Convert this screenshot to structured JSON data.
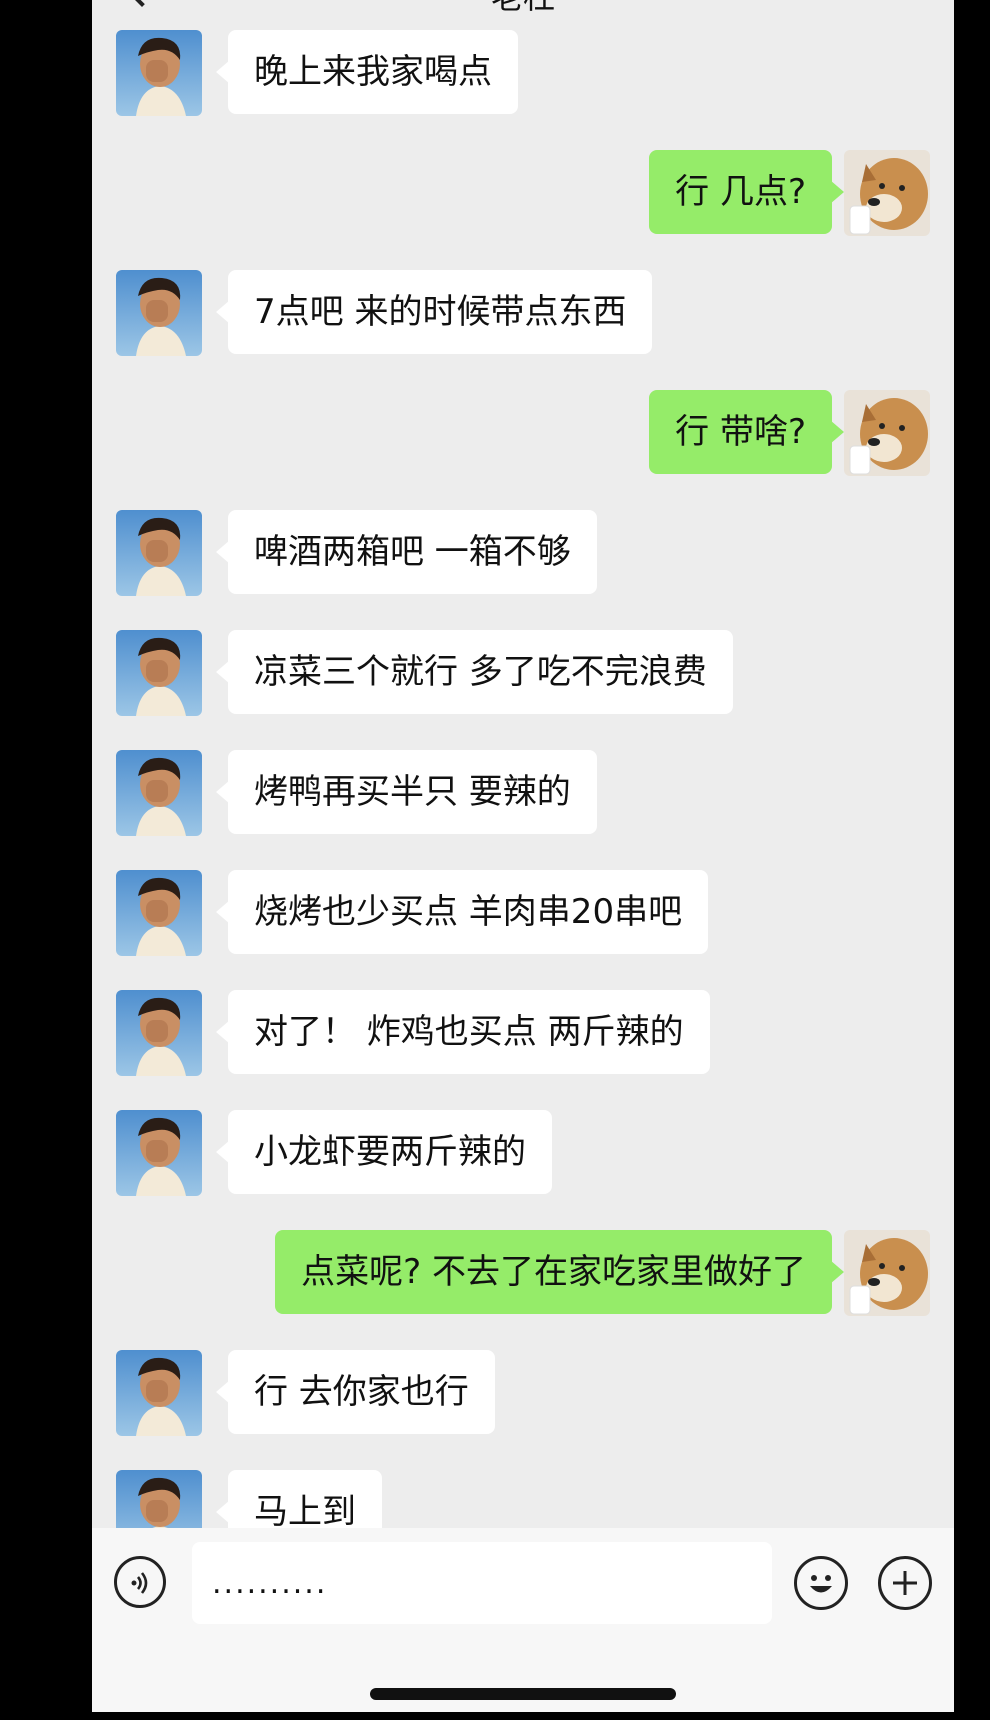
{
  "header": {
    "title": "老杜"
  },
  "messages": [
    {
      "side": "left",
      "text": "晚上来我家喝点"
    },
    {
      "side": "right",
      "text": "行 几点?"
    },
    {
      "side": "left",
      "text": "7点吧 来的时候带点东西"
    },
    {
      "side": "right",
      "text": "行 带啥?"
    },
    {
      "side": "left",
      "text": "啤酒两箱吧 一箱不够"
    },
    {
      "side": "left",
      "text": "凉菜三个就行 多了吃不完浪费"
    },
    {
      "side": "left",
      "text": "烤鸭再买半只 要辣的"
    },
    {
      "side": "left",
      "text": "烧烤也少买点 羊肉串20串吧"
    },
    {
      "side": "left",
      "text": "对了！ 炸鸡也买点 两斤辣的"
    },
    {
      "side": "left",
      "text": "小龙虾要两斤辣的"
    },
    {
      "side": "right",
      "text": "点菜呢? 不去了在家吃家里做好了"
    },
    {
      "side": "left",
      "text": "行 去你家也行"
    },
    {
      "side": "left",
      "text": "马上到"
    }
  ],
  "input_bar": {
    "value": "..........",
    "voice_icon": "voice-icon",
    "emoji_icon": "emoji-icon",
    "plus_icon": "plus-icon"
  },
  "colors": {
    "background": "#ededed",
    "self_bubble": "#95ec69",
    "other_bubble": "#ffffff"
  }
}
